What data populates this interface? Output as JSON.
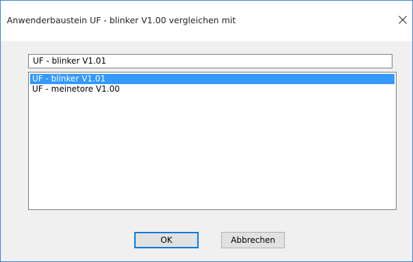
{
  "window": {
    "title": "Anwenderbaustein UF - blinker V1.00 vergleichen mit"
  },
  "search": {
    "value": "UF - blinker V1.01"
  },
  "list": {
    "items": [
      {
        "label": "UF - blinker V1.01",
        "selected": true
      },
      {
        "label": "UF - meinetore V1.00",
        "selected": false
      }
    ]
  },
  "buttons": {
    "ok_label": "OK",
    "cancel_label": "Abbrechen"
  },
  "colors": {
    "accent": "#0078d7",
    "selection": "#3399ff",
    "window_border": "#2b7fd6"
  },
  "icons": {
    "close": "close-icon"
  }
}
